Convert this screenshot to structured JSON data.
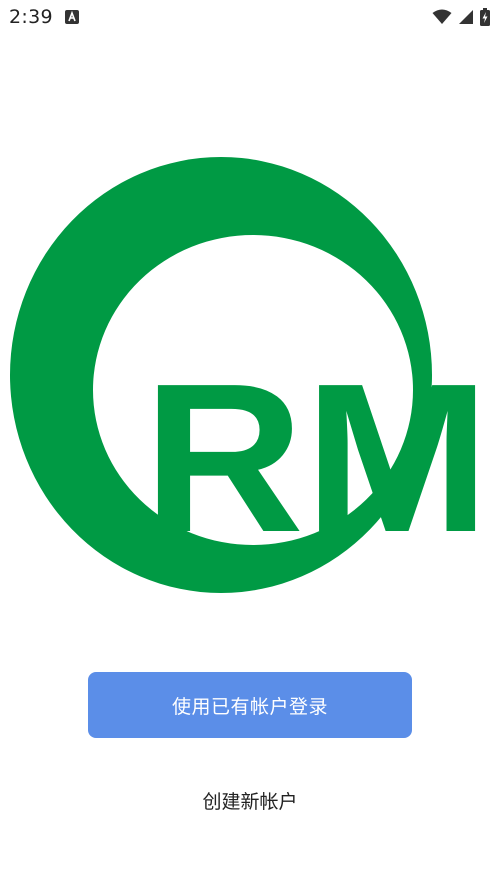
{
  "status_bar": {
    "time": "2:39",
    "notification_icon": "a-letter-notification-icon",
    "wifi_icon": "wifi-icon",
    "signal_icon": "cell-signal-icon",
    "battery_icon": "battery-charging-icon"
  },
  "logo": {
    "text": "RM",
    "color": "#009a44"
  },
  "actions": {
    "login_label": "使用已有帐户登录",
    "create_label": "创建新帐户"
  },
  "colors": {
    "brand_green": "#009a44",
    "button_blue": "#5b8ee8"
  }
}
